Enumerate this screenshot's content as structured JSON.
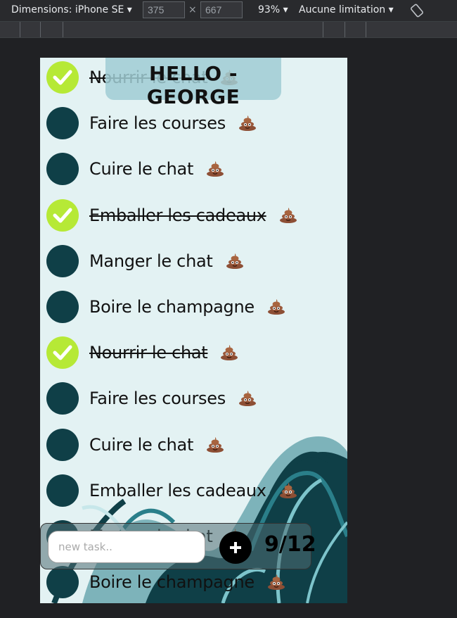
{
  "devtools": {
    "dimensions_label": "Dimensions: iPhone SE",
    "width_value": "375",
    "height_value": "667",
    "times_symbol": "×",
    "zoom": "93%",
    "throttling": "Aucune limitation"
  },
  "app": {
    "title": "HELLO - GEORGE",
    "input_placeholder": "new task..",
    "add_symbol": "+",
    "counter": "9/12",
    "colors": {
      "background": "#e3f2f3",
      "done_check": "#b6e936",
      "todo_check": "#0f3f47",
      "wave_dark": "#0f3f47",
      "wave_teal": "#2a7f8a"
    },
    "tasks": [
      {
        "label": "Nourrir le chat",
        "done": true
      },
      {
        "label": "Faire les courses",
        "done": false
      },
      {
        "label": "Cuire le chat",
        "done": false
      },
      {
        "label": "Emballer les cadeaux",
        "done": true
      },
      {
        "label": "Manger le chat",
        "done": false
      },
      {
        "label": "Boire le champagne",
        "done": false
      },
      {
        "label": "Nourrir le chat",
        "done": true
      },
      {
        "label": "Faire les courses",
        "done": false
      },
      {
        "label": "Cuire le chat",
        "done": false
      },
      {
        "label": "Emballer les cadeaux",
        "done": false
      },
      {
        "label": "Manger le chat",
        "done": false
      },
      {
        "label": "Boire le champagne",
        "done": false
      }
    ]
  }
}
